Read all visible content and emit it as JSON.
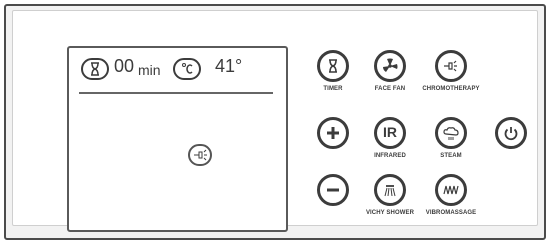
{
  "display": {
    "timer_value": "00",
    "timer_unit": "min",
    "temperature_value": "41°"
  },
  "controls": {
    "timer": "TIMER",
    "face_fan": "FACE FAN",
    "chromotherapy": "CHROMOTHERAPY",
    "infrared_symbol": "IR",
    "infrared": "INFRARED",
    "steam": "STEAM",
    "vichy_shower": "VICHY SHOWER",
    "vibromassage": "VIBROMASSAGE"
  },
  "icons": {
    "timer": "hourglass-icon",
    "temperature": "celsius-icon",
    "lamp": "lamp-icon",
    "face_fan": "fan-icon",
    "chromotherapy": "light-icon",
    "plus": "plus-icon",
    "minus": "minus-icon",
    "power": "power-icon",
    "steam": "cloud-icon",
    "vichy_shower": "shower-icon",
    "vibromassage": "wave-icon"
  },
  "colors": {
    "stroke": "#3c3c3c",
    "panel_background": "#ffffff",
    "frame_background": "#f2f2f2",
    "frame_border": "#4b4b4b"
  }
}
